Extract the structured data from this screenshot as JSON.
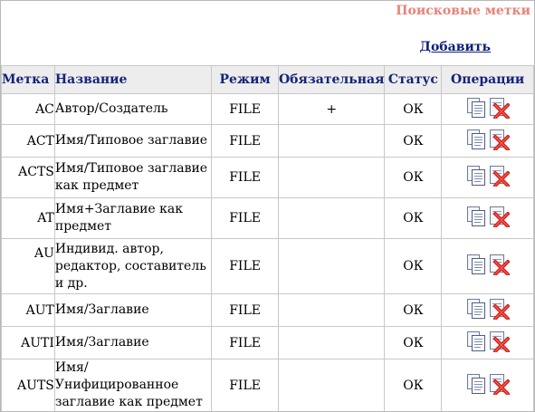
{
  "page": {
    "title": "Поисковые метки",
    "add_label": "Добавить"
  },
  "table": {
    "headers": {
      "tag": "Метка",
      "name": "Название",
      "mode": "Режим",
      "required": "Обязательная",
      "status": "Статус",
      "operations": "Операции"
    },
    "rows": [
      {
        "tag": "AC",
        "name": "Автор/Создатель",
        "mode": "FILE",
        "required": "+",
        "status": "ОК"
      },
      {
        "tag": "ACT",
        "name": "Имя/Типовое заглавие",
        "mode": "FILE",
        "required": "",
        "status": "ОК"
      },
      {
        "tag": "ACTS",
        "name": "Имя/Типовое заглавие как предмет",
        "mode": "FILE",
        "required": "",
        "status": "ОК"
      },
      {
        "tag": "AT",
        "name": "Имя+Заглавие как предмет",
        "mode": "FILE",
        "required": "",
        "status": "ОК"
      },
      {
        "tag": "AU",
        "name": "Индивид. автор, редактор, составитель и др.",
        "mode": "FILE",
        "required": "",
        "status": "ОК"
      },
      {
        "tag": "AUT",
        "name": "Имя/Заглавие",
        "mode": "FILE",
        "required": "",
        "status": "ОК"
      },
      {
        "tag": "AUTI",
        "name": "Имя/Заглавие",
        "mode": "FILE",
        "required": "",
        "status": "ОК"
      },
      {
        "tag": "AUTS",
        "name": "Имя/Унифицированное заглавие как предмет",
        "mode": "FILE",
        "required": "",
        "status": "ОК"
      }
    ]
  },
  "icons": {
    "edit": "document-copy-icon",
    "delete": "delete-x-icon"
  },
  "colors": {
    "title": "#e8837a",
    "header_text": "#14247a",
    "header_bg": "#ededed",
    "link": "#0b1f7a",
    "delete_red": "#d0201a"
  }
}
